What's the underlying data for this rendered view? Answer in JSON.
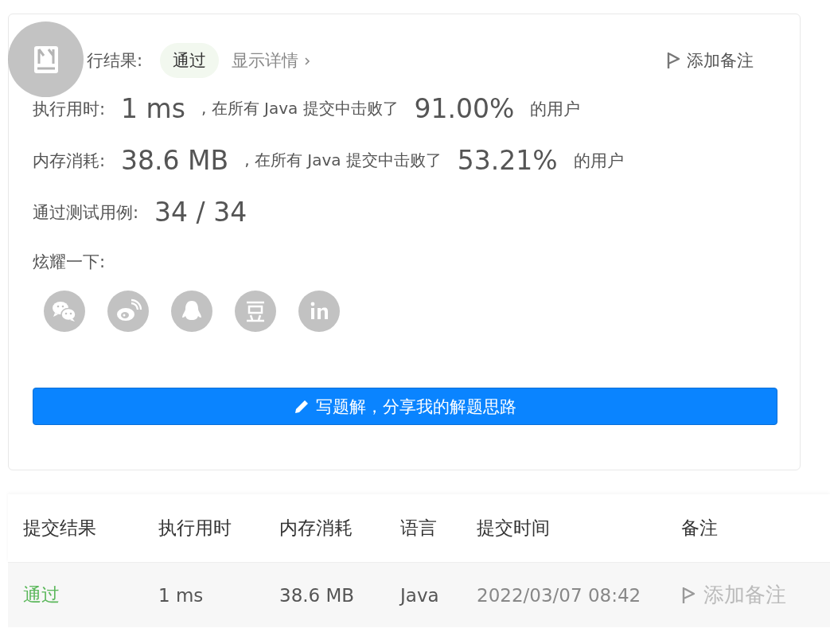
{
  "result": {
    "label": "行结果:",
    "status": "通过",
    "details_link": "显示详情",
    "add_note": "添加备注"
  },
  "stats": [
    {
      "label": "执行用时:",
      "value": "1 ms",
      "prefix": ", 在所有 Java 提交中击败了",
      "percent": "91.00%",
      "suffix": "的用户"
    },
    {
      "label": "内存消耗:",
      "value": "38.6 MB",
      "prefix": ", 在所有 Java 提交中击败了",
      "percent": "53.21%",
      "suffix": "的用户"
    }
  ],
  "tests": {
    "label": "通过测试用例:",
    "value": "34 / 34"
  },
  "share": {
    "label": "炫耀一下:",
    "icons": [
      {
        "kind": "wechat"
      },
      {
        "kind": "weibo"
      },
      {
        "kind": "qq"
      },
      {
        "kind": "douban"
      },
      {
        "kind": "linkedin"
      }
    ]
  },
  "write_button": "写题解，分享我的解题思路",
  "table": {
    "columns": [
      "提交结果",
      "执行用时",
      "内存消耗",
      "语言",
      "提交时间",
      "备注"
    ],
    "rows": [
      {
        "result": "通过",
        "kind": "accepted",
        "runtime": "1 ms",
        "memory": "38.6 MB",
        "language": "Java",
        "time": "2022/03/07 08:42",
        "note": "添加备注"
      }
    ]
  }
}
